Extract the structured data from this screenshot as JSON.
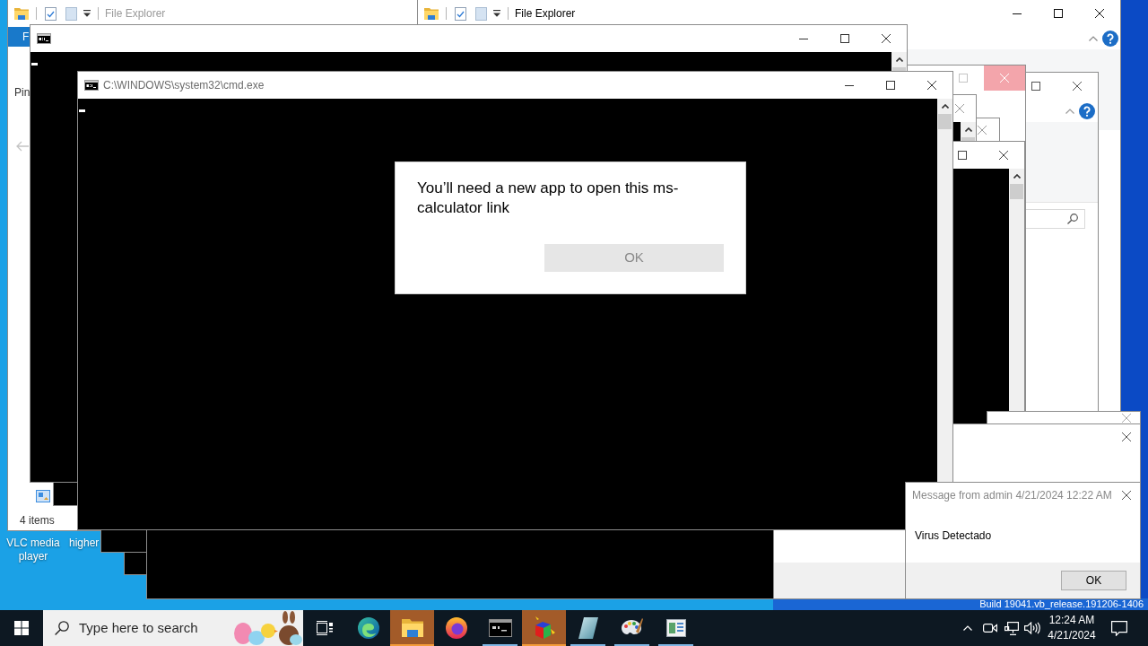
{
  "desktop": {
    "icons": [
      {
        "label": "VLC media player"
      },
      {
        "label": "higher"
      }
    ],
    "build_info": "Build 19041.vb_release.191206-1406"
  },
  "explorer_windows": [
    {
      "title": "File Explorer",
      "active": false,
      "ribbon_tab": "F",
      "ribbon_item": "Pin",
      "status": "4 items"
    },
    {
      "title": "File Explorer",
      "active": true
    }
  ],
  "console_window": {
    "title": "C:\\WINDOWS\\system32\\cmd.exe"
  },
  "app_dialog": {
    "message": "You’ll need a new app to open this ms-calculator link",
    "button": "OK"
  },
  "message_box": {
    "title": "Message from admin 4/21/2024 12:22 AM",
    "body": "Virus Detectado",
    "button": "OK"
  },
  "taskbar": {
    "search": {
      "placeholder": "Type here to search"
    },
    "apps": [
      {
        "kind": "swirl",
        "running": false,
        "flashing": false
      },
      {
        "kind": "folder",
        "running": true,
        "flashing": true
      },
      {
        "kind": "orb",
        "running": false,
        "flashing": false
      },
      {
        "kind": "console",
        "running": true,
        "flashing": false
      },
      {
        "kind": "cube",
        "running": true,
        "flashing": true
      },
      {
        "kind": "notepad",
        "running": true,
        "flashing": false
      },
      {
        "kind": "palette",
        "running": true,
        "flashing": false
      },
      {
        "kind": "window",
        "running": true,
        "flashing": false
      }
    ],
    "clock": {
      "time": "12:24 AM",
      "date": "4/21/2024"
    }
  }
}
